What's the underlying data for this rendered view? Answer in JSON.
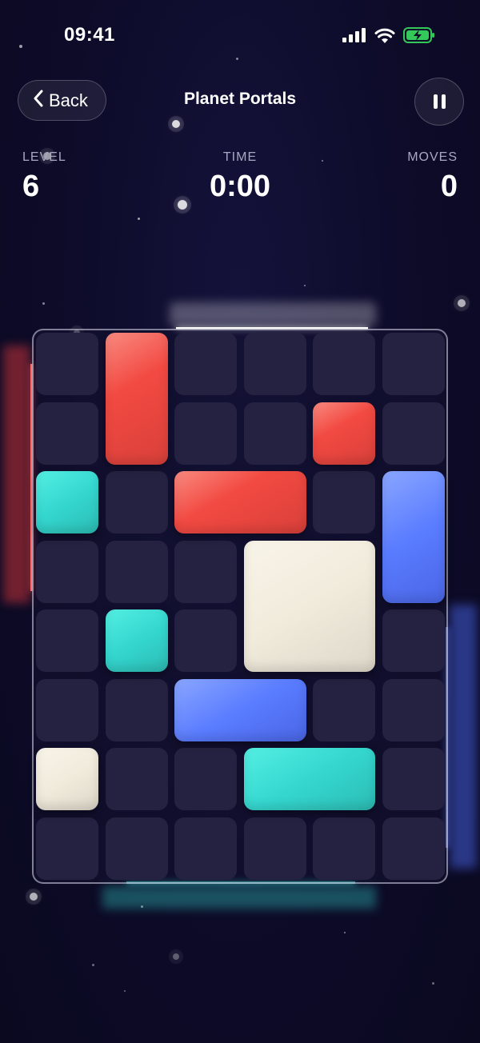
{
  "status_bar": {
    "time": "09:41",
    "icons": [
      "cellular-signal-icon",
      "wifi-icon",
      "battery-charging-icon"
    ]
  },
  "header": {
    "back_label": "Back",
    "title": "Planet Portals",
    "pause_icon": "pause-icon"
  },
  "stats": {
    "level_label": "LEVEL",
    "level_value": "6",
    "time_label": "TIME",
    "time_value": "0:00",
    "moves_label": "MOVES",
    "moves_value": "0"
  },
  "board": {
    "columns": 6,
    "rows": 8,
    "blocks": [
      {
        "color": "red",
        "col": 1,
        "row": 0,
        "w": 1,
        "h": 2
      },
      {
        "color": "red",
        "col": 4,
        "row": 1,
        "w": 1,
        "h": 1
      },
      {
        "color": "teal",
        "col": 0,
        "row": 2,
        "w": 1,
        "h": 1
      },
      {
        "color": "red",
        "col": 2,
        "row": 2,
        "w": 2,
        "h": 1
      },
      {
        "color": "blue",
        "col": 5,
        "row": 2,
        "w": 1,
        "h": 2
      },
      {
        "color": "cream",
        "col": 3,
        "row": 3,
        "w": 2,
        "h": 2
      },
      {
        "color": "teal",
        "col": 1,
        "row": 4,
        "w": 1,
        "h": 1
      },
      {
        "color": "blue",
        "col": 2,
        "row": 5,
        "w": 2,
        "h": 1
      },
      {
        "color": "cream",
        "col": 0,
        "row": 6,
        "w": 1,
        "h": 1
      },
      {
        "color": "teal",
        "col": 3,
        "row": 6,
        "w": 2,
        "h": 1
      }
    ],
    "portals": [
      {
        "side": "top",
        "color": "white"
      },
      {
        "side": "left",
        "color": "red"
      },
      {
        "side": "right",
        "color": "blue"
      },
      {
        "side": "bottom",
        "color": "teal"
      }
    ]
  },
  "colors": {
    "red": "#f24a42",
    "teal": "#34d7cf",
    "blue": "#5a7cff",
    "cream": "#f1ebdc",
    "background": "#0d0b28",
    "cell": "#252241"
  }
}
